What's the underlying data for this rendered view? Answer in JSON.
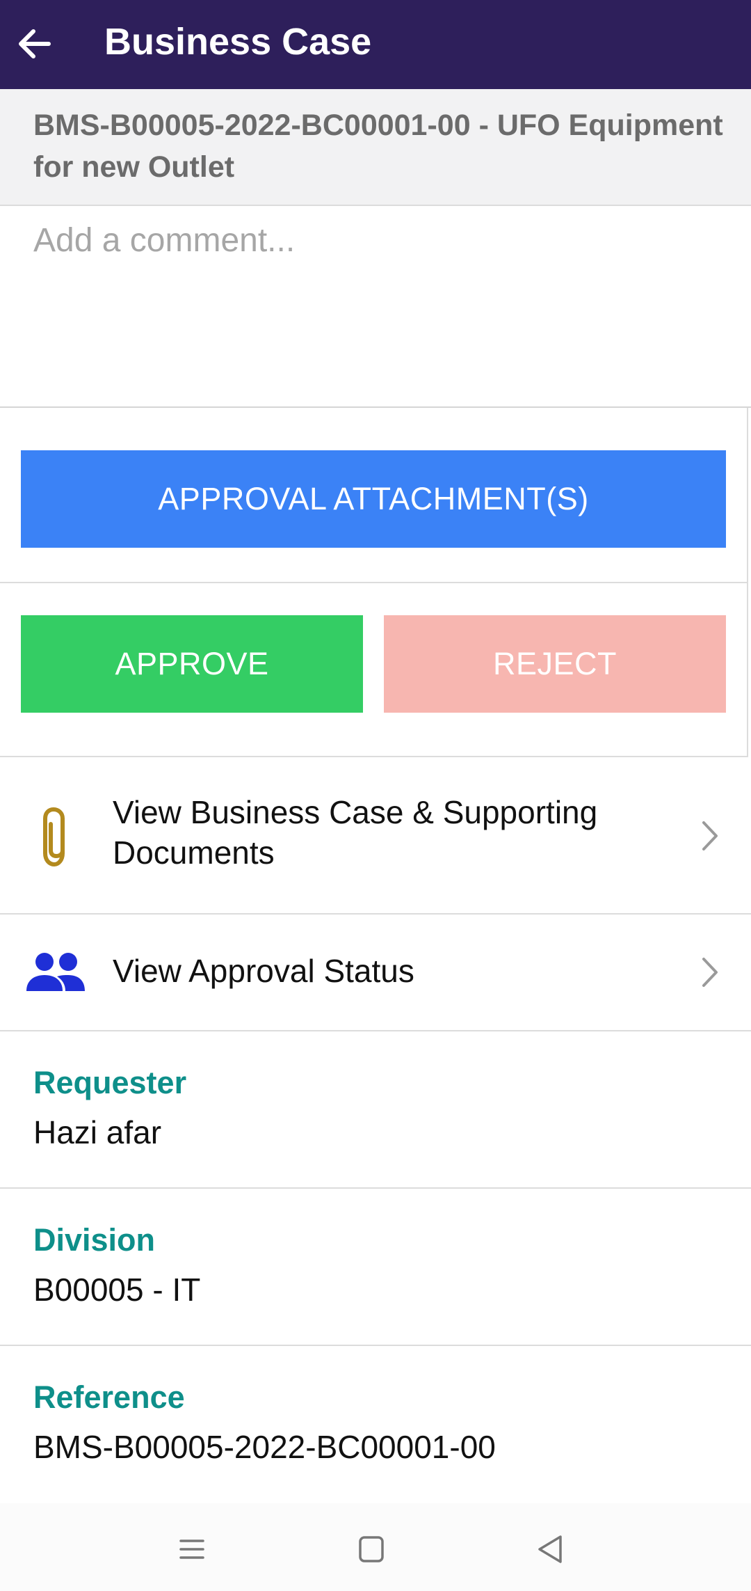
{
  "app_bar": {
    "title": "Business Case",
    "back_icon": "arrow-left-icon"
  },
  "subheader": {
    "title": "BMS-B00005-2022-BC00001-00 - UFO Equipment for new Outlet"
  },
  "comment": {
    "placeholder": "Add a comment..."
  },
  "buttons": {
    "attachments": "APPROVAL ATTACHMENT(S)",
    "approve": "APPROVE",
    "reject": "REJECT"
  },
  "links": [
    {
      "label": "View Business Case & Supporting Documents",
      "icon": "paperclip-icon"
    },
    {
      "label": "View Approval Status",
      "icon": "people-icon"
    }
  ],
  "details": [
    {
      "label": "Requester",
      "value": "Hazi afar"
    },
    {
      "label": "Division",
      "value": "B00005 - IT"
    },
    {
      "label": "Reference",
      "value": "BMS-B00005-2022-BC00001-00"
    }
  ],
  "colors": {
    "app_bar": "#2e1f5b",
    "attach_button": "#3b82f6",
    "approve_button": "#34cd64",
    "reject_button": "#f7b6b0",
    "detail_label": "#0e8f8a"
  },
  "system_nav": {
    "recents_icon": "menu-icon",
    "home_icon": "square-icon",
    "back_icon": "triangle-back-icon"
  }
}
